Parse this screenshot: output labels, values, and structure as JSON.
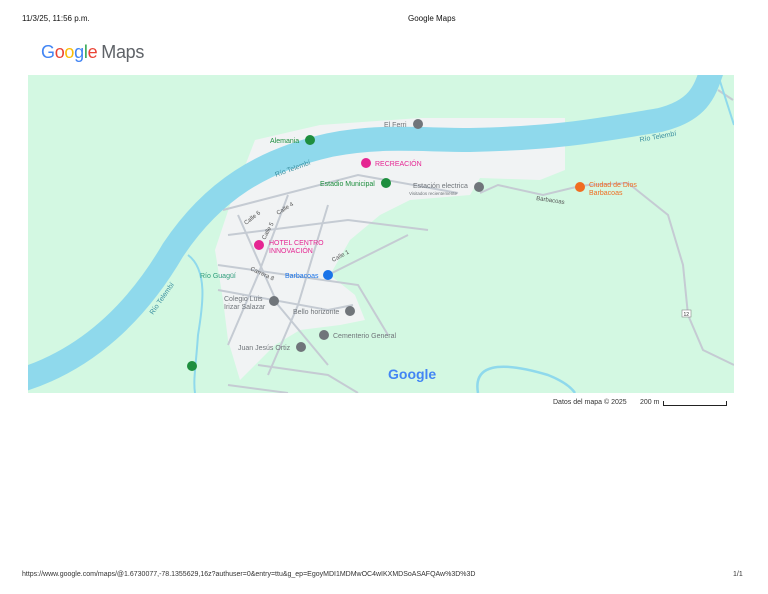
{
  "header": {
    "datetime": "11/3/25, 11:56 p.m.",
    "title": "Google Maps"
  },
  "logo": {
    "google": "Google",
    "maps": "Maps"
  },
  "map": {
    "colors": {
      "land": "#d3f8e2",
      "water": "#8fd9ec",
      "urban": "#f1f3f4",
      "road": "#c5cbd3",
      "poi_gray": "#70757a",
      "poi_green": "#1e8e3e",
      "poi_pink": "#e52592",
      "poi_blue": "#1a73e8",
      "poi_orange": "#f06d21"
    },
    "rivers": [
      "Río Telembí",
      "Río Telembí",
      "Río Telembí",
      "Río Guagüí"
    ],
    "streets": [
      "Calle 6",
      "Calle 4",
      "Calle 5",
      "Calle 1",
      "Carrera 8",
      "Barbacoas"
    ],
    "places": [
      {
        "name": "El Ferri",
        "icon": "pin-icon",
        "color": "gray"
      },
      {
        "name": "Alemania",
        "icon": "park-icon",
        "color": "green"
      },
      {
        "name": "RECREACIÓN",
        "icon": "hotel-icon",
        "color": "pink"
      },
      {
        "name": "Estadio Municipal",
        "icon": "stadium-icon",
        "color": "green"
      },
      {
        "name": "Estación electrica",
        "sub": "Visitados recientemente",
        "icon": "pin-icon",
        "color": "gray"
      },
      {
        "name": "Ciudad de Dios Barbacoas",
        "icon": "restaurant-icon",
        "color": "orange"
      },
      {
        "name": "HOTEL CENTRO INNOVACIÓN",
        "icon": "hotel-icon",
        "color": "pink"
      },
      {
        "name": "Barbacoas",
        "icon": "shopping-icon",
        "color": "blue"
      },
      {
        "name": "Colegio Luis Irizar Salazar",
        "icon": "school-icon",
        "color": "gray"
      },
      {
        "name": "Bello horizonte",
        "icon": "pin-icon",
        "color": "gray"
      },
      {
        "name": "Cementerio General",
        "icon": "cemetery-icon",
        "color": "gray"
      },
      {
        "name": "Juan Jesús Ortiz",
        "icon": "pin-icon",
        "color": "gray"
      }
    ],
    "route_shield": "12",
    "watermark": "Google"
  },
  "footer": {
    "attribution": "Datos del mapa © 2025",
    "scale": "200 m",
    "url": "https://www.google.com/maps/@1.6730077,-78.1355629,16z?authuser=0&entry=ttu&g_ep=EgoyMDI1MDMwOC4wIKXMDSoASAFQAw%3D%3D",
    "page": "1/1"
  }
}
